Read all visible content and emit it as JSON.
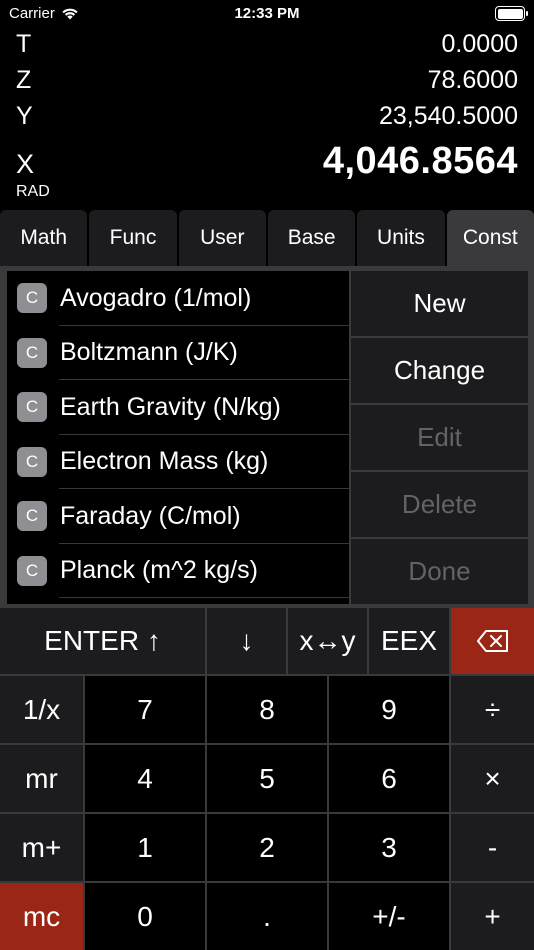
{
  "status_bar": {
    "carrier": "Carrier",
    "time": "12:33 PM"
  },
  "stack": {
    "t": {
      "label": "T",
      "value": "0.0000"
    },
    "z": {
      "label": "Z",
      "value": "78.6000"
    },
    "y": {
      "label": "Y",
      "value": "23,540.5000"
    },
    "x": {
      "label": "X",
      "value": "4,046.8564"
    },
    "mode": "RAD"
  },
  "tabs": [
    "Math",
    "Func",
    "User",
    "Base",
    "Units",
    "Const"
  ],
  "active_tab": "Const",
  "constants": [
    {
      "badge": "C",
      "name": "Avogadro (1/mol)"
    },
    {
      "badge": "C",
      "name": "Boltzmann (J/K)"
    },
    {
      "badge": "C",
      "name": "Earth Gravity (N/kg)"
    },
    {
      "badge": "C",
      "name": "Electron Mass (kg)"
    },
    {
      "badge": "C",
      "name": "Faraday (C/mol)"
    },
    {
      "badge": "C",
      "name": "Planck (m^2 kg/s)"
    }
  ],
  "actions": {
    "new": "New",
    "change": "Change",
    "edit": "Edit",
    "delete": "Delete",
    "done": "Done"
  },
  "keys": {
    "enter": "ENTER ↑",
    "roll_down": "↓",
    "swap": "x↔y",
    "eex": "EEX",
    "backspace_icon": "backspace-icon",
    "reciprocal": "1/x",
    "mr": "mr",
    "mplus": "m+",
    "mc": "mc",
    "d7": "7",
    "d8": "8",
    "d9": "9",
    "d4": "4",
    "d5": "5",
    "d6": "6",
    "d1": "1",
    "d2": "2",
    "d3": "3",
    "d0": "0",
    "dot": ".",
    "sign": "+/-",
    "divide": "÷",
    "multiply": "×",
    "minus": "-",
    "plus": "+"
  },
  "colors": {
    "background": "#000000",
    "panel": "#3a3a3c",
    "key_red": "#9a2615",
    "disabled_text": "#636366"
  }
}
